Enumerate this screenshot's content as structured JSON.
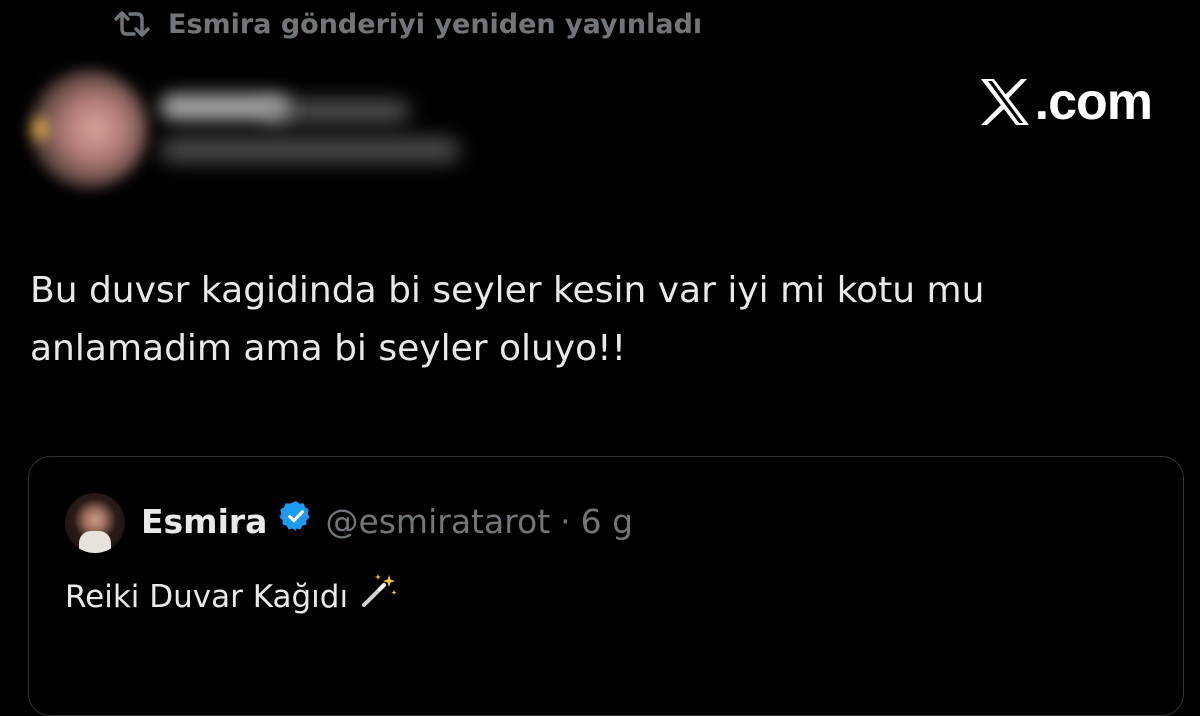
{
  "repost": {
    "icon": "repost-icon",
    "label": "Esmira gönderiyi yeniden yayınladı",
    "color": "#71767b"
  },
  "author": {
    "avatar_blurred": true,
    "name_blurred": true
  },
  "watermark": {
    "logo": "x-logo-icon",
    "suffix": ".com"
  },
  "tweet": {
    "text": "Bu duvsr kagidinda bi seyler kesin var iyi mi kotu mu\nanlamadim ama bi seyler oluyo!!"
  },
  "quote": {
    "name": "Esmira",
    "verified_icon": "verified-badge-icon",
    "verified_color": "#1d9bf0",
    "handle": "@esmiratarot",
    "separator": "·",
    "time": "6 g",
    "text": "Reiki Duvar Kağıdı",
    "emoji": "magic-wand-icon"
  },
  "colors": {
    "background": "#000000",
    "text": "#e7e9ea",
    "muted": "#71767b",
    "border": "#2f3336",
    "accent": "#1d9bf0"
  }
}
